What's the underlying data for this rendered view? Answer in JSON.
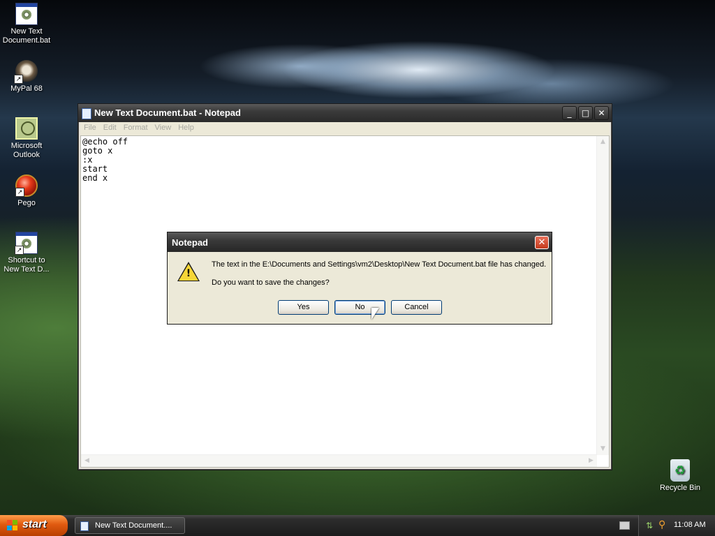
{
  "desktop": {
    "icons": [
      {
        "label_line1": "New Text",
        "label_line2": "Document.bat",
        "icon": "bat-file-icon"
      },
      {
        "label_line1": "MyPal 68",
        "label_line2": "",
        "icon": "mypal-icon"
      },
      {
        "label_line1": "Microsoft",
        "label_line2": "Outlook",
        "icon": "outlook-icon"
      },
      {
        "label_line1": "Pego",
        "label_line2": "",
        "icon": "pego-icon"
      },
      {
        "label_line1": "Shortcut to",
        "label_line2": "New Text D...",
        "icon": "bat-shortcut-icon"
      }
    ],
    "recycle_bin": {
      "label": "Recycle Bin",
      "icon": "recycle-bin-icon"
    }
  },
  "notepad": {
    "title": "New Text Document.bat - Notepad",
    "menu": [
      "File",
      "Edit",
      "Format",
      "View",
      "Help"
    ],
    "content": "@echo off\ngoto x\n:x\nstart\nend x",
    "buttons": {
      "minimize": "_",
      "maximize": "□",
      "close": "✕"
    }
  },
  "dialog": {
    "title": "Notepad",
    "message_line1": "The text in the E:\\Documents and Settings\\vm2\\Desktop\\New Text Document.bat file has changed.",
    "message_line2": "Do you want to save the changes?",
    "buttons": {
      "yes": "Yes",
      "no": "No",
      "cancel": "Cancel"
    },
    "close_glyph": "✕",
    "icon": "warning-icon"
  },
  "taskbar": {
    "start_label": "start",
    "task_label": "New Text Document....",
    "clock": "11:08 AM"
  },
  "colors": {
    "accent_start": "#e05a10",
    "titlebar": "#3a3a3a",
    "dialog_bg": "#ece9d8"
  }
}
